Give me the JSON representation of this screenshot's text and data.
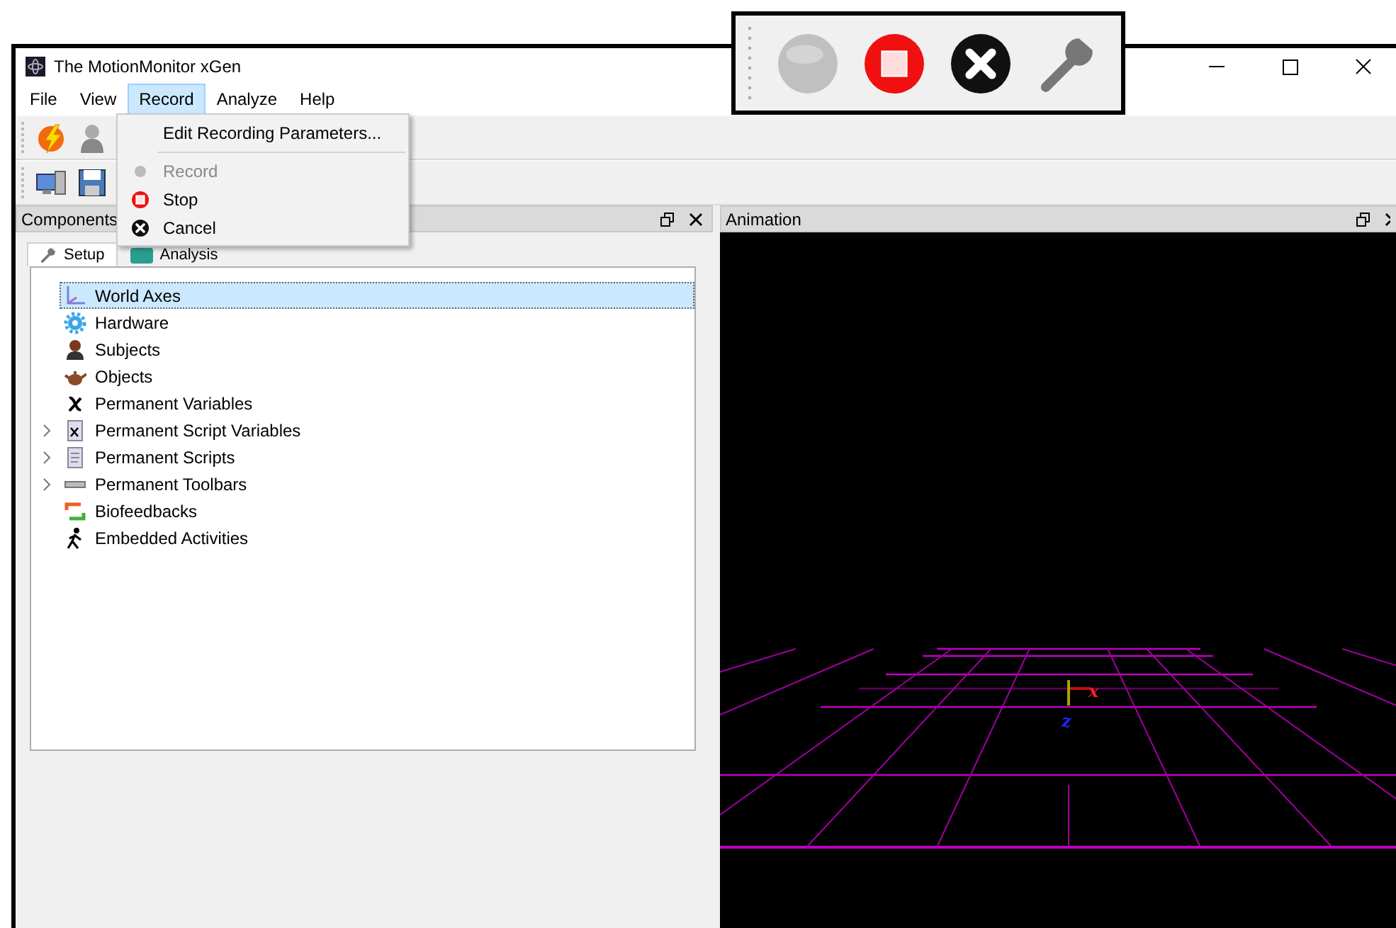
{
  "window": {
    "title": "The MotionMonitor xGen"
  },
  "menu_bar": [
    {
      "label": "File",
      "selected": false
    },
    {
      "label": "View",
      "selected": false
    },
    {
      "label": "Record",
      "selected": true
    },
    {
      "label": "Analyze",
      "selected": false
    },
    {
      "label": "Help",
      "selected": false
    }
  ],
  "record_menu": [
    {
      "kind": "plain",
      "label": "Edit Recording Parameters...",
      "disabled": false
    },
    {
      "kind": "separator"
    },
    {
      "kind": "record",
      "label": "Record",
      "disabled": true
    },
    {
      "kind": "stop",
      "label": "Stop",
      "disabled": false
    },
    {
      "kind": "cancel",
      "label": "Cancel",
      "disabled": false
    }
  ],
  "toolbars": [
    [
      {
        "kind": "lightning"
      },
      {
        "kind": "person"
      }
    ],
    [
      {
        "kind": "computer"
      },
      {
        "kind": "floppy"
      }
    ]
  ],
  "floating_toolbar": [
    {
      "kind": "record",
      "disabled": true
    },
    {
      "kind": "stop",
      "disabled": false
    },
    {
      "kind": "cancel",
      "disabled": false
    },
    {
      "kind": "wrench",
      "disabled": false
    }
  ],
  "components_panel": {
    "title": "Components",
    "tabs": [
      {
        "label": "Setup",
        "kind": "wrench",
        "selected": true
      },
      {
        "label": "Analysis",
        "kind": "chart",
        "selected": false
      }
    ],
    "tree": [
      {
        "label": "World Axes",
        "kind": "axes",
        "expandable": false,
        "selected": true
      },
      {
        "label": "Hardware",
        "kind": "gear",
        "expandable": false,
        "selected": false
      },
      {
        "label": "Subjects",
        "kind": "person",
        "expandable": false,
        "selected": false
      },
      {
        "label": "Objects",
        "kind": "teapot",
        "expandable": false,
        "selected": false
      },
      {
        "label": "Permanent Variables",
        "kind": "variable",
        "expandable": false,
        "selected": false
      },
      {
        "label": "Permanent Script Variables",
        "kind": "scriptvar",
        "expandable": true,
        "selected": false
      },
      {
        "label": "Permanent Scripts",
        "kind": "script",
        "expandable": true,
        "selected": false
      },
      {
        "label": "Permanent Toolbars",
        "kind": "toolbar",
        "expandable": true,
        "selected": false
      },
      {
        "label": "Biofeedbacks",
        "kind": "loop",
        "expandable": false,
        "selected": false
      },
      {
        "label": "Embedded Activities",
        "kind": "walker",
        "expandable": false,
        "selected": false
      }
    ]
  },
  "animation_panel": {
    "title": "Animation",
    "axis_labels": [
      {
        "label": "x",
        "color": "#ff2020"
      },
      {
        "label": "z",
        "color": "#2020ff"
      }
    ]
  }
}
